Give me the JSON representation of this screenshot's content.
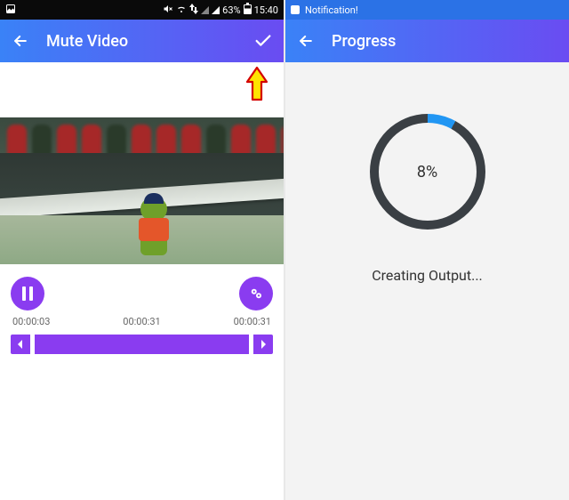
{
  "left": {
    "statusbar": {
      "battery_pct": "63%",
      "time": "15:40"
    },
    "appbar": {
      "title": "Mute Video"
    },
    "times": {
      "current": "00:00:03",
      "mid": "00:00:31",
      "end": "00:00:31"
    }
  },
  "right": {
    "statusbar": {
      "notification": "Notification!"
    },
    "appbar": {
      "title": "Progress"
    },
    "progress": {
      "percent_label": "8%",
      "percent_value": 8,
      "status": "Creating Output..."
    }
  }
}
